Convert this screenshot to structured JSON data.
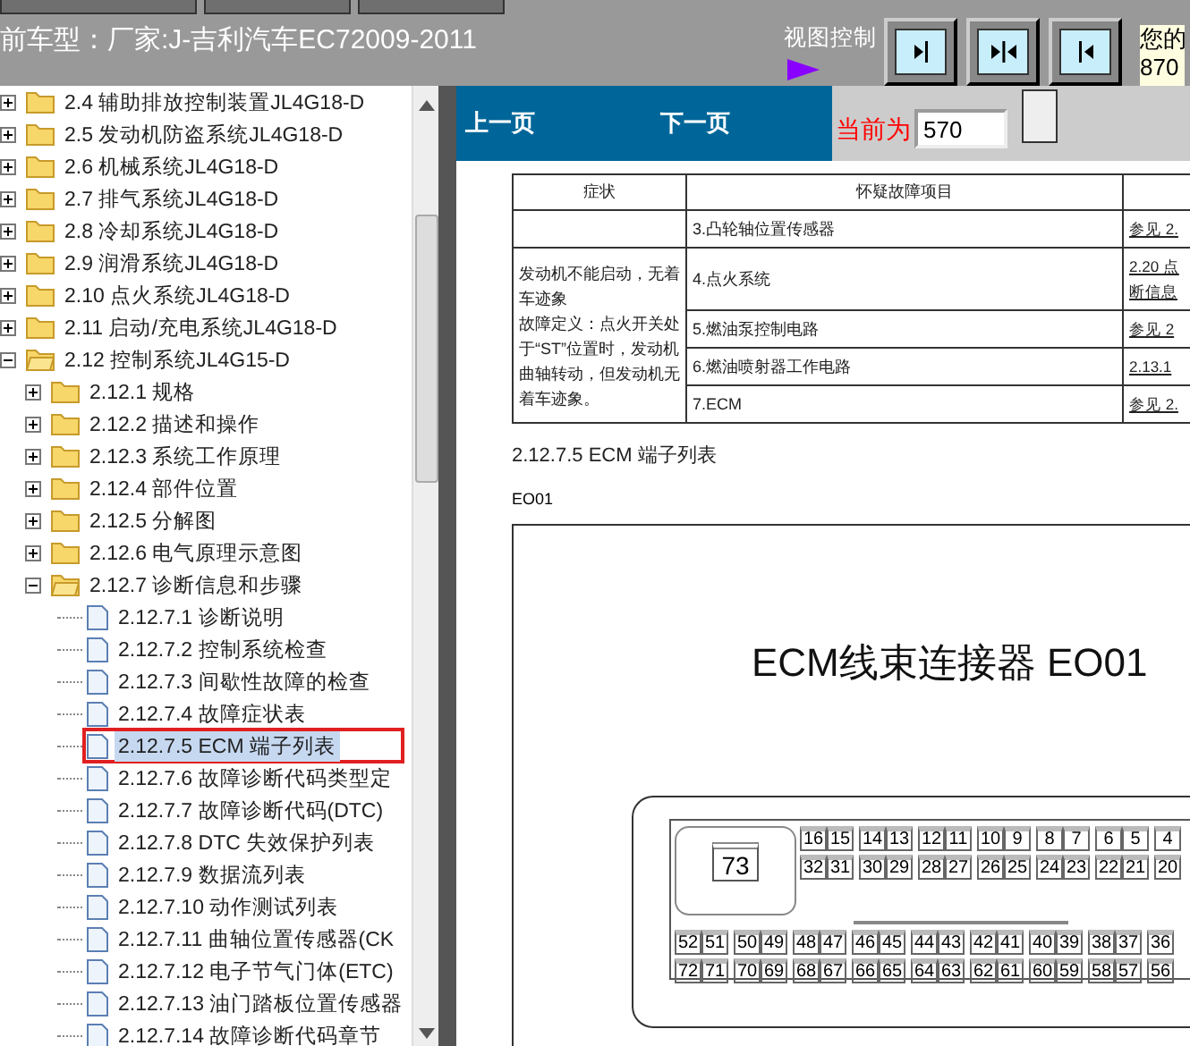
{
  "header": {
    "vehicle": "前车型：厂家:J-吉利汽车EC72009-2011",
    "view_control_label": "视图控制",
    "user_info": [
      "您的",
      "870"
    ]
  },
  "view_buttons": [
    {
      "kind": "right"
    },
    {
      "kind": "center"
    },
    {
      "kind": "left"
    }
  ],
  "tree": [
    {
      "label": "2.4 辅助排放控制装置JL4G18-D",
      "kind": "folder",
      "expanded": false,
      "selected": false
    },
    {
      "label": "2.5 发动机防盗系统JL4G18-D",
      "kind": "folder",
      "expanded": false,
      "selected": false
    },
    {
      "label": "2.6 机械系统JL4G18-D",
      "kind": "folder",
      "expanded": false,
      "selected": false
    },
    {
      "label": "2.7 排气系统JL4G18-D",
      "kind": "folder",
      "expanded": false,
      "selected": false
    },
    {
      "label": "2.8 冷却系统JL4G18-D",
      "kind": "folder",
      "expanded": false,
      "selected": false
    },
    {
      "label": "2.9 润滑系统JL4G18-D",
      "kind": "folder",
      "expanded": false,
      "selected": false
    },
    {
      "label": "2.10 点火系统JL4G18-D",
      "kind": "folder",
      "expanded": false,
      "selected": false
    },
    {
      "label": "2.11 启动/充电系统JL4G18-D",
      "kind": "folder",
      "expanded": false,
      "selected": false
    },
    {
      "label": "2.12 控制系统JL4G15-D",
      "kind": "folder",
      "expanded": true,
      "selected": false,
      "children": [
        {
          "label": "2.12.1 规格",
          "kind": "folder",
          "expanded": false,
          "selected": false
        },
        {
          "label": "2.12.2 描述和操作",
          "kind": "folder",
          "expanded": false,
          "selected": false
        },
        {
          "label": "2.12.3 系统工作原理",
          "kind": "folder",
          "expanded": false,
          "selected": false
        },
        {
          "label": "2.12.4 部件位置",
          "kind": "folder",
          "expanded": false,
          "selected": false
        },
        {
          "label": "2.12.5 分解图",
          "kind": "folder",
          "expanded": false,
          "selected": false
        },
        {
          "label": "2.12.6 电气原理示意图",
          "kind": "folder",
          "expanded": false,
          "selected": false
        },
        {
          "label": "2.12.7 诊断信息和步骤",
          "kind": "folder",
          "expanded": true,
          "selected": false,
          "children": [
            {
              "label": "2.12.7.1 诊断说明",
              "kind": "page",
              "selected": false
            },
            {
              "label": "2.12.7.2 控制系统检查",
              "kind": "page",
              "selected": false
            },
            {
              "label": "2.12.7.3 间歇性故障的检查",
              "kind": "page",
              "selected": false
            },
            {
              "label": "2.12.7.4 故障症状表",
              "kind": "page",
              "selected": false
            },
            {
              "label": "2.12.7.5 ECM 端子列表",
              "kind": "page",
              "selected": true
            },
            {
              "label": "2.12.7.6 故障诊断代码类型定",
              "kind": "page",
              "selected": false
            },
            {
              "label": "2.12.7.7 故障诊断代码(DTC)",
              "kind": "page",
              "selected": false
            },
            {
              "label": "2.12.7.8 DTC 失效保护列表",
              "kind": "page",
              "selected": false
            },
            {
              "label": "2.12.7.9 数据流列表",
              "kind": "page",
              "selected": false
            },
            {
              "label": "2.12.7.10 动作测试列表",
              "kind": "page",
              "selected": false
            },
            {
              "label": "2.12.7.11 曲轴位置传感器(CK",
              "kind": "page",
              "selected": false
            },
            {
              "label": "2.12.7.12 电子节气门体(ETC)",
              "kind": "page",
              "selected": false
            },
            {
              "label": "2.12.7.13 油门踏板位置传感器",
              "kind": "page",
              "selected": false
            },
            {
              "label": "2.12.7.14 故障诊断代码章节",
              "kind": "page",
              "selected": false
            }
          ]
        }
      ]
    }
  ],
  "pager": {
    "prev": "上一页",
    "next": "下一页",
    "current_label": "当前为",
    "page": "570"
  },
  "document": {
    "table": {
      "columns": [
        "症状",
        "怀疑故障项目"
      ],
      "symptom": [
        "发动机不能启动，无着车迹象",
        "故障定义：点火开关处于“ST”位置时，发动机曲轴转动，但发动机无着车迹象。"
      ],
      "rows": [
        {
          "cause": "3.凸轮轴位置传感器",
          "ref": [
            "参见 2."
          ]
        },
        {
          "cause": "4.点火系统",
          "ref": [
            "2.20 点",
            "断信息"
          ]
        },
        {
          "cause": "5.燃油泵控制电路",
          "ref": [
            "参见 2"
          ]
        },
        {
          "cause": "6.燃油喷射器工作电路",
          "ref": [
            "2.13.1"
          ]
        },
        {
          "cause": "7.ECM",
          "ref": [
            "参见 2."
          ]
        }
      ]
    },
    "section_title": "2.12.7.5 ECM 端子列表",
    "connector_id": "EO01",
    "diagram": {
      "title": "ECM线束连接器 EO01",
      "pad": "73",
      "pin_rows": [
        [
          "16",
          "15",
          "14",
          "13",
          "12",
          "11",
          "10",
          "9",
          "8",
          "7",
          "6",
          "5",
          "4"
        ],
        [
          "32",
          "31",
          "30",
          "29",
          "28",
          "27",
          "26",
          "25",
          "24",
          "23",
          "22",
          "21",
          "20"
        ],
        [
          "52",
          "51",
          "50",
          "49",
          "48",
          "47",
          "46",
          "45",
          "44",
          "43",
          "42",
          "41",
          "40",
          "39",
          "38",
          "37",
          "36"
        ],
        [
          "72",
          "71",
          "70",
          "69",
          "68",
          "67",
          "66",
          "65",
          "64",
          "63",
          "62",
          "61",
          "60",
          "59",
          "58",
          "57",
          "56"
        ]
      ]
    }
  }
}
